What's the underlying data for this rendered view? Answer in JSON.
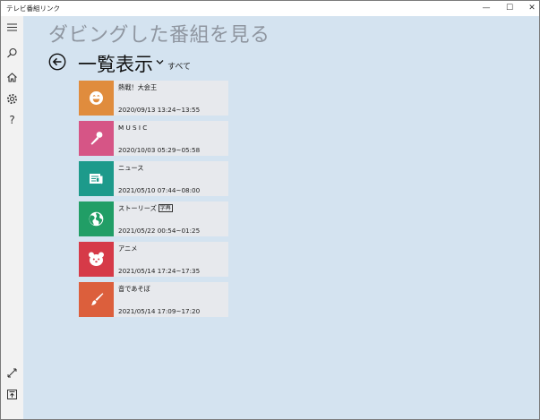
{
  "window": {
    "app_title": "テレビ番組リンク",
    "minimize_glyph": "—",
    "maximize_glyph": "☐",
    "close_glyph": "✕"
  },
  "sidebar": {
    "top_icons": [
      "hamburger-menu-icon",
      "search-icon",
      "home-icon",
      "settings-gear-icon",
      "help-question-icon"
    ],
    "bottom_icons": [
      "fullscreen-arrows-icon",
      "upload-icon"
    ],
    "help_glyph": "?"
  },
  "header": {
    "page_title": "ダビングした番組を見る",
    "list_title": "一覧表示",
    "filter_label": "すべて"
  },
  "programs": [
    {
      "name": "熱戦！大会王",
      "time": "2020/09/13 13:24~13:55",
      "badge": "",
      "color": "#e08c3d",
      "icon": "smiley-face-icon"
    },
    {
      "name": "M U S I C",
      "time": "2020/10/03 05:29~05:58",
      "badge": "",
      "color": "#d65586",
      "icon": "microphone-icon"
    },
    {
      "name": "ニュース",
      "time": "2021/05/10 07:44~08:00",
      "badge": "",
      "color": "#1d9a8b",
      "icon": "newspaper-icon"
    },
    {
      "name": "ストーリーズ",
      "time": "2021/05/22 00:54~01:25",
      "badge": "字再",
      "color": "#219e66",
      "icon": "globe-icon"
    },
    {
      "name": "アニメ",
      "time": "2021/05/14 17:24~17:35",
      "badge": "",
      "color": "#d63a48",
      "icon": "bear-face-icon"
    },
    {
      "name": "音であそぼ",
      "time": "2021/05/14 17:09~17:20",
      "badge": "",
      "color": "#dc5f3c",
      "icon": "paintbrush-icon"
    }
  ],
  "colors": {
    "content_bg": "#d4e3f0",
    "sidebar_bg": "#f2f2f2",
    "card_bg": "#e7e9ed",
    "title_gray": "#8f96a0"
  }
}
